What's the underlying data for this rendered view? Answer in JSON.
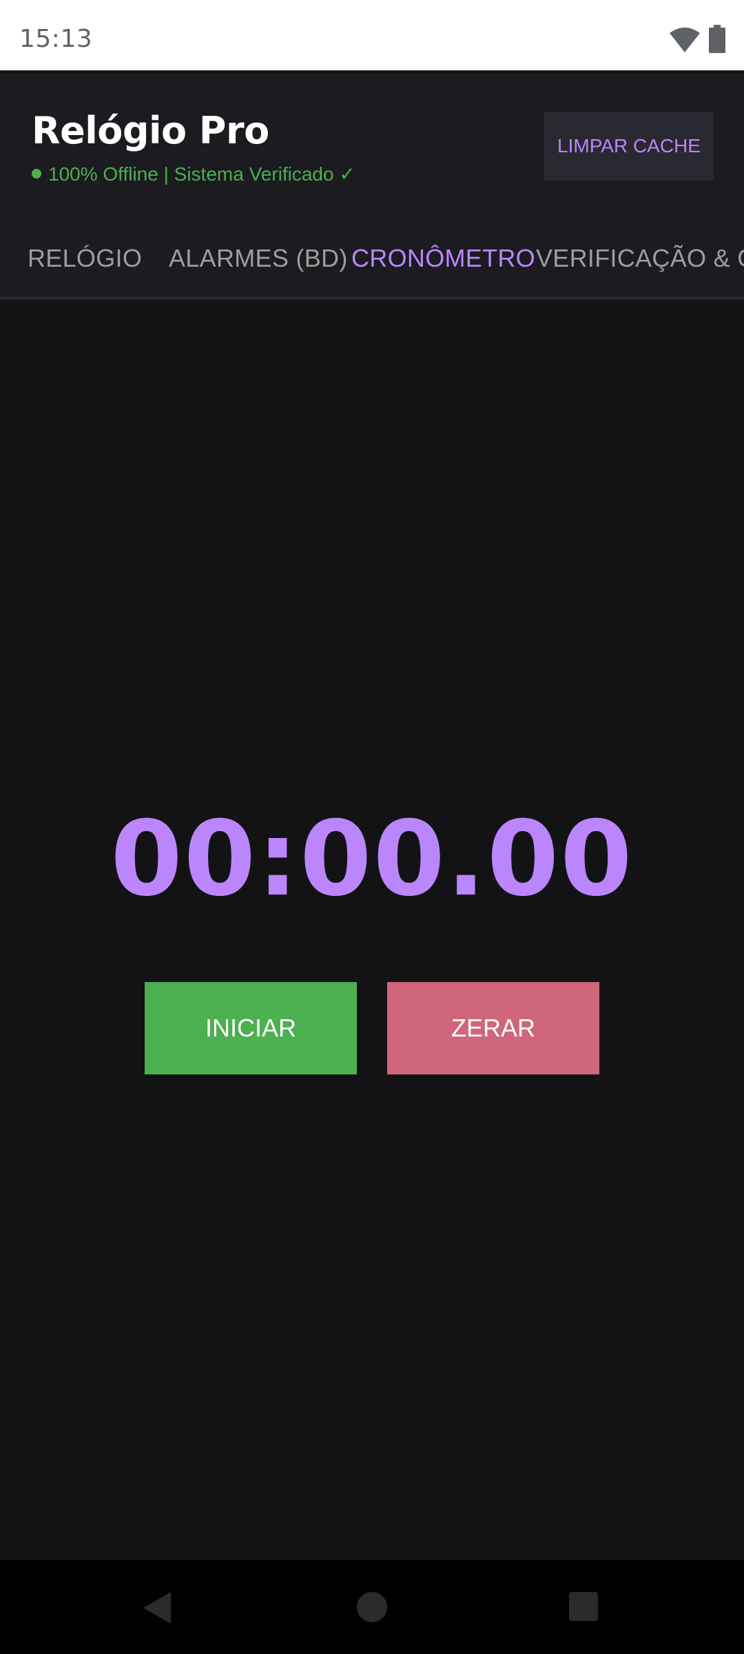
{
  "status_bar": {
    "time": "15:13",
    "icons": [
      "wifi-icon",
      "battery-icon"
    ]
  },
  "header": {
    "title": "Relógio Pro",
    "status": "100% Offline | Sistema Verificado ✓",
    "clear_cache_label": "LIMPAR CACHE"
  },
  "tabs": [
    {
      "label": "RELÓGIO",
      "active": false
    },
    {
      "label": "ALARMES (BD)",
      "active": false
    },
    {
      "label": "CRONÔMETRO",
      "active": true
    },
    {
      "label": "VERIFICAÇÃO & C",
      "active": false
    }
  ],
  "stopwatch": {
    "display": "00:00.00",
    "start_label": "INICIAR",
    "reset_label": "ZERAR"
  },
  "nav": {
    "icons": [
      "back-icon",
      "home-icon",
      "recents-icon"
    ]
  },
  "colors": {
    "background": "#131315",
    "header": "#1b1b20",
    "accent": "#bb86fc",
    "success": "#4caf50",
    "danger": "#d0667a"
  }
}
